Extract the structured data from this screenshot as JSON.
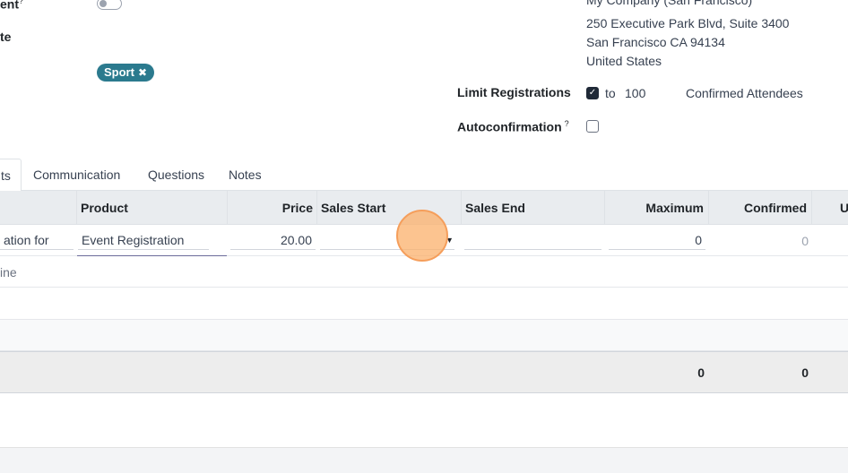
{
  "form": {
    "toggle_label_partial": "ent",
    "toggle_superscript": "?",
    "date_label_partial": "te",
    "tag": {
      "label": "Sport",
      "remove": "✖"
    },
    "address": {
      "company_partial": "My Company (San Francisco)",
      "line1": "250 Executive Park Blvd, Suite 3400",
      "line2": "San Francisco CA 94134",
      "line3": "United States"
    },
    "limit_registrations": {
      "label": "Limit Registrations",
      "checked": true,
      "to_label": "to",
      "value": "100",
      "suffix": "Confirmed Attendees"
    },
    "autoconfirmation": {
      "label": "Autoconfirmation",
      "help": "?",
      "checked": false
    }
  },
  "tabs": [
    {
      "label": "ts",
      "active": true
    },
    {
      "label": "Communication",
      "active": false
    },
    {
      "label": "Questions",
      "active": false
    },
    {
      "label": "Notes",
      "active": false
    }
  ],
  "table": {
    "headers": {
      "product": "Product",
      "price": "Price",
      "sales_start": "Sales Start",
      "sales_end": "Sales End",
      "maximum": "Maximum",
      "confirmed": "Confirmed",
      "unconfirmed_partial": "U"
    },
    "row": {
      "name_partial": "ation for",
      "product": "Event Registration",
      "price": "20.00",
      "sales_start": "",
      "sales_end": "",
      "maximum": "0",
      "confirmed": "0"
    },
    "add_line_partial": "ine",
    "totals": {
      "maximum": "0",
      "confirmed": "0"
    }
  }
}
